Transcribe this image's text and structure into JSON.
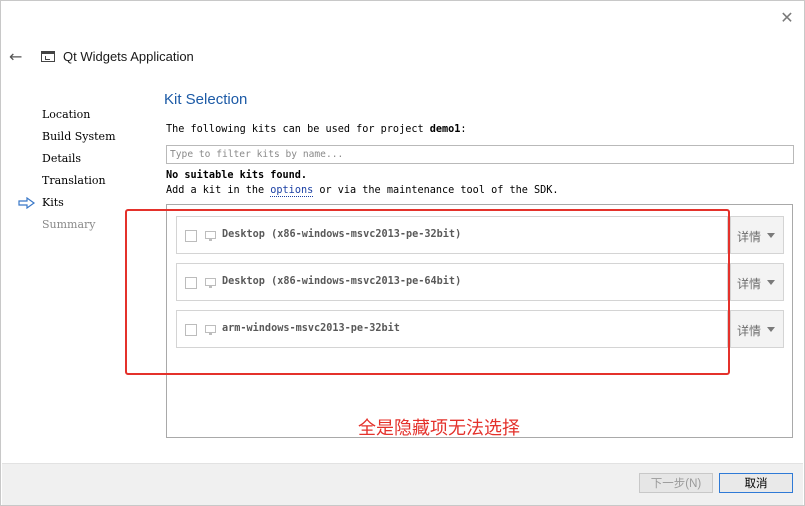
{
  "window": {
    "title": "Qt Widgets Application",
    "close_glyph": "✕",
    "back_glyph": "←"
  },
  "steps": [
    {
      "label": "Location",
      "state": "done"
    },
    {
      "label": "Build System",
      "state": "done"
    },
    {
      "label": "Details",
      "state": "done"
    },
    {
      "label": "Translation",
      "state": "done"
    },
    {
      "label": "Kits",
      "state": "current"
    },
    {
      "label": "Summary",
      "state": "pending"
    }
  ],
  "page": {
    "heading": "Kit Selection",
    "desc_prefix": "The following kits can be used for project ",
    "project_name": "demo1",
    "desc_suffix": ":",
    "filter_placeholder": "Type to filter kits by name...",
    "no_kits": "No suitable kits found.",
    "add_prefix": "Add a kit in the ",
    "add_link": "options",
    "add_suffix": " or via the maintenance tool of the SDK."
  },
  "kits": [
    {
      "label": "Desktop (x86-windows-msvc2013-pe-32bit)",
      "details_label": "详情",
      "checked": false
    },
    {
      "label": "Desktop (x86-windows-msvc2013-pe-64bit)",
      "details_label": "详情",
      "checked": false
    },
    {
      "label": "arm-windows-msvc2013-pe-32bit",
      "details_label": "详情",
      "checked": false
    }
  ],
  "annotation": {
    "text": "全是隐藏项无法选择",
    "color": "#e4312b"
  },
  "buttons": {
    "next_label": "下一步(N)",
    "cancel_label": "取消"
  },
  "colors": {
    "accent": "#1c5aa6",
    "highlight": "#e4312b",
    "focus_border": "#2f7ad6"
  }
}
